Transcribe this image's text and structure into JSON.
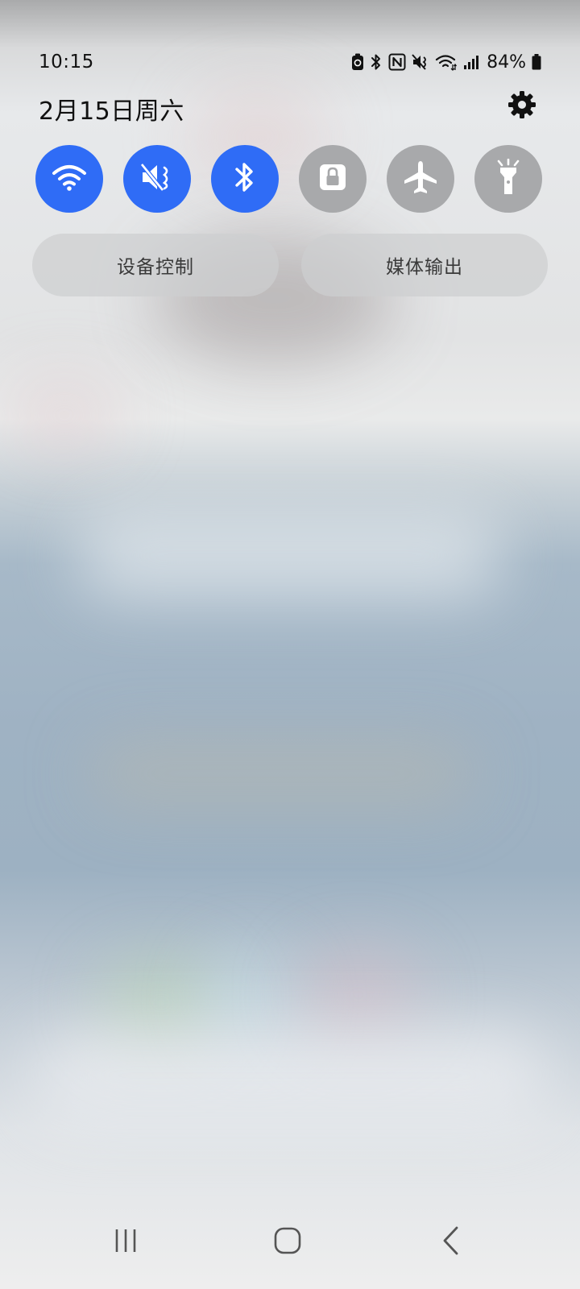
{
  "status_bar": {
    "time": "10:15",
    "battery_percent": "84%",
    "icons": [
      "battery-saver-icon",
      "bluetooth-icon",
      "nfc-icon",
      "mute-icon",
      "wifi-icon",
      "signal-icon",
      "battery-icon"
    ]
  },
  "header": {
    "date": "2月15日周六",
    "settings_icon": "gear-icon"
  },
  "quick_toggles": [
    {
      "name": "wifi",
      "icon": "wifi-icon",
      "state": "on"
    },
    {
      "name": "mute",
      "icon": "mute-icon",
      "state": "on"
    },
    {
      "name": "bluetooth",
      "icon": "bluetooth-icon",
      "state": "on"
    },
    {
      "name": "rotation-lock",
      "icon": "lock-icon",
      "state": "off"
    },
    {
      "name": "airplane-mode",
      "icon": "airplane-icon",
      "state": "off"
    },
    {
      "name": "flashlight",
      "icon": "flashlight-icon",
      "state": "off"
    }
  ],
  "buttons": {
    "device_control": "设备控制",
    "media_output": "媒体输出"
  },
  "nav": {
    "recent": "recent-apps-icon",
    "home": "home-icon",
    "back": "back-icon"
  },
  "colors": {
    "toggle_on": "#2f6cf6",
    "toggle_off": "#a8a9ab"
  }
}
